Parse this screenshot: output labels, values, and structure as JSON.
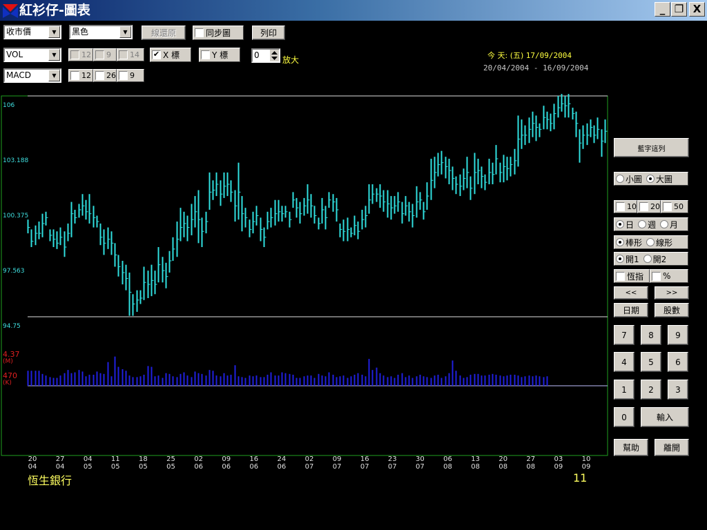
{
  "window": {
    "title": "紅衫仔-圖表",
    "minimize": "_",
    "restore": "❐",
    "close": "X"
  },
  "toolbar": {
    "price_select": "收市價",
    "color_select": "黑色",
    "reset_button": "線還原",
    "sync_label": "同步圖",
    "print_button": "列印",
    "indicator1_select": "VOL",
    "vol_params": [
      "12",
      "9",
      "14"
    ],
    "x_axis_label": "X 標",
    "x_axis_checked": true,
    "y_axis_label": "Y 標",
    "zoom_value": "0",
    "zoom_label": "放大",
    "indicator2_select": "MACD",
    "macd_params": [
      "12",
      "26",
      "9"
    ]
  },
  "info": {
    "today_label": "今 天: (五)",
    "today_date": "17/09/2004",
    "range": "20/04/2004 - 16/09/2004"
  },
  "y_axis_labels": [
    "106",
    "103.188",
    "100.375",
    "97.563",
    "94.75"
  ],
  "volume_labels": {
    "max_value": "4.37",
    "max_unit": "(M)",
    "min_value": "470",
    "min_unit": "(K)"
  },
  "stock": {
    "name": "恆生銀行",
    "code": "11"
  },
  "right_panel": {
    "indicator_list_button": "藍字這列",
    "size_small": "小圖",
    "size_large": "大圖",
    "size_selected": "large",
    "ma_checks": [
      "10",
      "20",
      "50"
    ],
    "period_day": "日",
    "period_week": "週",
    "period_month": "月",
    "chart_bar": "棒形",
    "chart_line": "線形",
    "open1": "開1",
    "open2": "開2",
    "hsi_label": "恆指",
    "percent_label": "%",
    "prev_button": "<<",
    "next_button": ">>",
    "date_button": "日期",
    "shares_button": "股數",
    "keypad": [
      "7",
      "8",
      "9",
      "4",
      "5",
      "6",
      "1",
      "2",
      "3"
    ],
    "zero_button": "0",
    "enter_button": "輸入",
    "help_button": "幫助",
    "exit_button": "離開"
  },
  "chart_data": {
    "type": "bar",
    "ylim": [
      94.75,
      106
    ],
    "x_ticks": [
      {
        "day": "20",
        "month": "04"
      },
      {
        "day": "27",
        "month": "04"
      },
      {
        "day": "04",
        "month": "05"
      },
      {
        "day": "11",
        "month": "05"
      },
      {
        "day": "18",
        "month": "05"
      },
      {
        "day": "25",
        "month": "05"
      },
      {
        "day": "02",
        "month": "06"
      },
      {
        "day": "09",
        "month": "06"
      },
      {
        "day": "16",
        "month": "06"
      },
      {
        "day": "24",
        "month": "06"
      },
      {
        "day": "02",
        "month": "07"
      },
      {
        "day": "09",
        "month": "07"
      },
      {
        "day": "16",
        "month": "07"
      },
      {
        "day": "23",
        "month": "07"
      },
      {
        "day": "30",
        "month": "07"
      },
      {
        "day": "06",
        "month": "08"
      },
      {
        "day": "13",
        "month": "08"
      },
      {
        "day": "20",
        "month": "08"
      },
      {
        "day": "27",
        "month": "08"
      },
      {
        "day": "03",
        "month": "09"
      },
      {
        "day": "10",
        "month": "09"
      }
    ],
    "ohlc": [
      [
        99.7,
        99.0,
        99.3
      ],
      [
        99.2,
        98.3,
        98.6
      ],
      [
        99.4,
        98.4,
        99.0
      ],
      [
        99.6,
        98.7,
        99.0
      ],
      [
        100.0,
        98.8,
        99.5
      ],
      [
        100.1,
        99.4,
        99.8
      ],
      [
        99.2,
        98.6,
        98.9
      ],
      [
        99.2,
        98.3,
        98.7
      ],
      [
        99.1,
        98.2,
        98.5
      ],
      [
        99.3,
        98.4,
        98.8
      ],
      [
        99.1,
        97.8,
        98.3
      ],
      [
        99.5,
        98.6,
        99.0
      ],
      [
        100.6,
        98.8,
        100.0
      ],
      [
        100.2,
        99.5,
        99.8
      ],
      [
        100.5,
        99.8,
        100.2
      ],
      [
        101.0,
        99.9,
        100.4
      ],
      [
        100.7,
        99.7,
        100.1
      ],
      [
        101.0,
        99.5,
        100.0
      ],
      [
        100.4,
        99.3,
        99.8
      ],
      [
        99.9,
        99.3,
        99.6
      ],
      [
        99.5,
        98.4,
        98.8
      ],
      [
        99.2,
        97.9,
        98.5
      ],
      [
        99.3,
        98.2,
        98.7
      ],
      [
        99.1,
        97.9,
        98.5
      ],
      [
        98.5,
        97.3,
        97.9
      ],
      [
        97.9,
        96.8,
        97.3
      ],
      [
        97.6,
        96.4,
        97.0
      ],
      [
        97.4,
        96.1,
        96.7
      ],
      [
        97.0,
        94.8,
        96.0
      ],
      [
        95.9,
        94.8,
        95.4
      ],
      [
        96.1,
        95.0,
        95.6
      ],
      [
        96.1,
        95.4,
        95.7
      ],
      [
        97.3,
        95.6,
        96.5
      ],
      [
        97.1,
        95.7,
        96.4
      ],
      [
        97.4,
        95.8,
        96.6
      ],
      [
        97.1,
        95.9,
        96.4
      ],
      [
        98.3,
        96.5,
        97.4
      ],
      [
        97.8,
        96.5,
        97.1
      ],
      [
        97.5,
        96.2,
        96.8
      ],
      [
        98.1,
        97.0,
        97.6
      ],
      [
        98.8,
        97.6,
        98.2
      ],
      [
        99.6,
        97.8,
        98.7
      ],
      [
        100.3,
        98.6,
        99.3
      ],
      [
        100.1,
        98.8,
        99.5
      ],
      [
        99.9,
        98.6,
        99.3
      ],
      [
        100.5,
        98.9,
        99.7
      ],
      [
        100.9,
        99.3,
        100.1
      ],
      [
        101.2,
        98.5,
        99.7
      ],
      [
        99.8,
        98.3,
        99.1
      ],
      [
        100.1,
        99.0,
        99.6
      ],
      [
        102.1,
        100.2,
        101.1
      ],
      [
        101.7,
        100.7,
        101.2
      ],
      [
        102.1,
        100.9,
        101.5
      ],
      [
        101.7,
        100.4,
        101.0
      ],
      [
        102.1,
        100.8,
        101.4
      ],
      [
        102.1,
        100.9,
        101.5
      ],
      [
        101.7,
        100.6,
        101.1
      ],
      [
        101.2,
        99.6,
        100.4
      ],
      [
        102.6,
        99.7,
        101.1
      ],
      [
        100.9,
        99.1,
        100.0
      ],
      [
        100.3,
        99.3,
        99.8
      ],
      [
        99.7,
        98.8,
        99.2
      ],
      [
        100.1,
        99.0,
        99.6
      ],
      [
        100.4,
        99.4,
        99.9
      ],
      [
        99.8,
        98.6,
        99.2
      ],
      [
        99.3,
        98.3,
        98.8
      ],
      [
        100.1,
        99.2,
        99.6
      ],
      [
        100.3,
        99.3,
        99.8
      ],
      [
        100.7,
        99.4,
        100.0
      ],
      [
        100.7,
        99.6,
        100.1
      ],
      [
        100.4,
        99.6,
        100.0
      ],
      [
        100.4,
        99.8,
        100.1
      ],
      [
        100.1,
        99.3,
        99.7
      ],
      [
        101.1,
        100.3,
        100.7
      ],
      [
        100.8,
        99.8,
        100.3
      ],
      [
        100.6,
        99.5,
        100.0
      ],
      [
        100.8,
        99.9,
        100.4
      ],
      [
        101.5,
        100.0,
        100.7
      ],
      [
        101.0,
        99.8,
        100.4
      ],
      [
        100.4,
        99.5,
        99.9
      ],
      [
        99.8,
        99.2,
        99.5
      ],
      [
        100.8,
        99.5,
        100.2
      ],
      [
        100.4,
        99.2,
        99.8
      ],
      [
        101.1,
        100.3,
        100.7
      ],
      [
        101.0,
        100.1,
        100.6
      ],
      [
        100.8,
        99.6,
        100.2
      ],
      [
        99.5,
        98.8,
        99.2
      ],
      [
        99.7,
        98.6,
        99.1
      ],
      [
        99.8,
        98.6,
        99.2
      ],
      [
        99.3,
        98.8,
        99.0
      ],
      [
        99.9,
        98.9,
        99.4
      ],
      [
        99.6,
        98.7,
        99.1
      ],
      [
        100.2,
        99.2,
        99.7
      ],
      [
        100.4,
        99.3,
        99.9
      ],
      [
        101.5,
        100.0,
        100.7
      ],
      [
        101.5,
        100.5,
        101.0
      ],
      [
        101.3,
        100.6,
        101.0
      ],
      [
        101.5,
        100.3,
        100.9
      ],
      [
        101.2,
        100.1,
        100.6
      ],
      [
        101.2,
        99.8,
        100.5
      ],
      [
        100.9,
        99.7,
        100.3
      ],
      [
        100.9,
        100.0,
        100.4
      ],
      [
        101.1,
        100.1,
        100.6
      ],
      [
        100.6,
        99.5,
        100.0
      ],
      [
        100.9,
        99.9,
        100.4
      ],
      [
        100.6,
        99.6,
        100.1
      ],
      [
        100.5,
        99.3,
        99.9
      ],
      [
        101.4,
        99.8,
        100.6
      ],
      [
        101.1,
        100.2,
        100.7
      ],
      [
        100.6,
        99.7,
        100.1
      ],
      [
        101.6,
        100.2,
        100.9
      ],
      [
        102.8,
        100.7,
        101.7
      ],
      [
        102.9,
        101.3,
        102.1
      ],
      [
        103.1,
        101.9,
        102.5
      ],
      [
        103.2,
        102.0,
        102.6
      ],
      [
        102.9,
        101.8,
        102.4
      ],
      [
        102.8,
        101.5,
        102.2
      ],
      [
        102.4,
        101.2,
        101.8
      ],
      [
        101.9,
        101.0,
        101.5
      ],
      [
        102.0,
        100.9,
        101.4
      ],
      [
        102.3,
        101.2,
        101.8
      ],
      [
        102.9,
        101.3,
        102.1
      ],
      [
        101.9,
        100.7,
        101.3
      ],
      [
        103.1,
        101.0,
        102.1
      ],
      [
        102.8,
        101.5,
        102.2
      ],
      [
        102.4,
        101.3,
        101.9
      ],
      [
        102.0,
        101.2,
        101.6
      ],
      [
        102.8,
        101.5,
        102.1
      ],
      [
        102.6,
        101.5,
        102.0
      ],
      [
        103.5,
        102.0,
        102.8
      ],
      [
        102.6,
        101.6,
        102.1
      ],
      [
        103.0,
        101.6,
        102.4
      ],
      [
        102.9,
        101.7,
        102.3
      ],
      [
        102.9,
        101.9,
        102.5
      ],
      [
        103.3,
        102.0,
        102.7
      ],
      [
        105.0,
        102.4,
        103.8
      ],
      [
        104.8,
        103.3,
        104.0
      ],
      [
        104.5,
        103.5,
        104.0
      ],
      [
        104.9,
        103.6,
        104.3
      ],
      [
        105.2,
        103.9,
        104.6
      ],
      [
        105.0,
        103.7,
        104.4
      ],
      [
        104.6,
        103.9,
        104.3
      ],
      [
        105.5,
        104.3,
        104.9
      ],
      [
        105.2,
        104.3,
        104.8
      ],
      [
        105.1,
        104.2,
        104.6
      ],
      [
        105.6,
        104.3,
        105.1
      ],
      [
        106.0,
        104.9,
        105.4
      ],
      [
        106.1,
        105.2,
        105.6
      ],
      [
        106.0,
        104.9,
        105.5
      ],
      [
        106.1,
        104.9,
        105.6
      ],
      [
        105.4,
        104.8,
        105.1
      ],
      [
        105.2,
        103.9,
        104.6
      ],
      [
        104.3,
        102.6,
        103.6
      ],
      [
        104.5,
        103.3,
        104.0
      ],
      [
        104.6,
        103.5,
        104.0
      ],
      [
        104.8,
        103.9,
        104.4
      ],
      [
        104.5,
        103.6,
        104.0
      ],
      [
        104.9,
        103.8,
        104.3
      ],
      [
        104.3,
        102.9,
        103.7
      ],
      [
        104.8,
        103.6,
        104.2
      ]
    ],
    "volume": [
      1.9,
      1.9,
      1.9,
      1.9,
      1.5,
      1.3,
      1.1,
      1.0,
      1.0,
      1.3,
      1.6,
      2.0,
      1.6,
      1.7,
      2.0,
      1.8,
      1.2,
      1.4,
      1.4,
      1.8,
      1.6,
      1.5,
      3.0,
      1.2,
      3.7,
      2.4,
      2.1,
      1.9,
      1.3,
      1.1,
      1.1,
      1.2,
      1.4,
      2.5,
      2.4,
      1.2,
      1.3,
      1.0,
      1.6,
      1.5,
      1.2,
      1.1,
      1.5,
      1.7,
      1.3,
      1.1,
      1.8,
      1.6,
      1.5,
      1.3,
      2.0,
      1.9,
      1.3,
      1.2,
      1.6,
      1.3,
      1.4,
      2.6,
      1.2,
      1.1,
      1.0,
      1.3,
      1.2,
      1.3,
      1.1,
      1.1,
      1.4,
      1.7,
      1.3,
      1.3,
      1.7,
      1.6,
      1.5,
      1.4,
      1.0,
      1.0,
      1.2,
      1.3,
      1.3,
      1.0,
      1.5,
      1.3,
      1.2,
      1.7,
      1.4,
      1.1,
      1.2,
      1.3,
      1.0,
      1.2,
      1.4,
      1.6,
      1.4,
      1.2,
      3.4,
      2.0,
      2.3,
      1.6,
      1.3,
      1.1,
      1.2,
      1.0,
      1.4,
      1.6,
      1.1,
      1.3,
      1.0,
      1.2,
      1.4,
      1.2,
      1.1,
      1.0,
      1.3,
      1.4,
      1.0,
      1.2,
      1.6,
      3.2,
      1.9,
      1.3,
      1.0,
      1.1,
      1.4,
      1.5,
      1.5,
      1.3,
      1.3,
      1.4,
      1.5,
      1.4,
      1.3,
      1.2,
      1.3,
      1.4,
      1.4,
      1.3,
      1.1,
      1.2,
      1.3,
      1.2,
      1.3,
      1.2,
      1.1,
      1.2
    ]
  }
}
